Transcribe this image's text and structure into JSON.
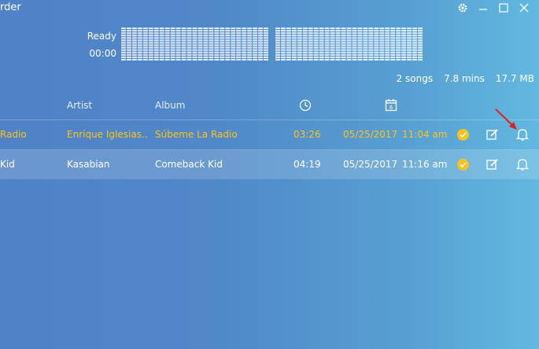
{
  "window": {
    "title": "rder"
  },
  "status": {
    "state": "Ready",
    "time": "00:00"
  },
  "summary": {
    "songs": "2 songs",
    "duration": "7.8 mins",
    "size": "17.7 MB"
  },
  "columns": {
    "artist": "Artist",
    "album": "Album"
  },
  "rows": [
    {
      "title": "Radio",
      "artist": "Enrique Iglesias...",
      "album": "Súbeme La Radio",
      "length": "03:26",
      "date": "05/25/2017",
      "time": "11:04 am"
    },
    {
      "title": "Kid",
      "artist": "Kasabian",
      "album": "Comeback Kid",
      "length": "04:19",
      "date": "05/25/2017",
      "time": "11:16 am"
    }
  ],
  "colors": {
    "highlight": "#ffc21a",
    "check": "#f7c21e",
    "arrow": "#e02020"
  },
  "icons": [
    "gear-icon",
    "minimize-icon",
    "maximize-icon",
    "close-icon",
    "clock-icon",
    "calendar-icon",
    "check-icon",
    "edit-icon",
    "bell-icon"
  ]
}
